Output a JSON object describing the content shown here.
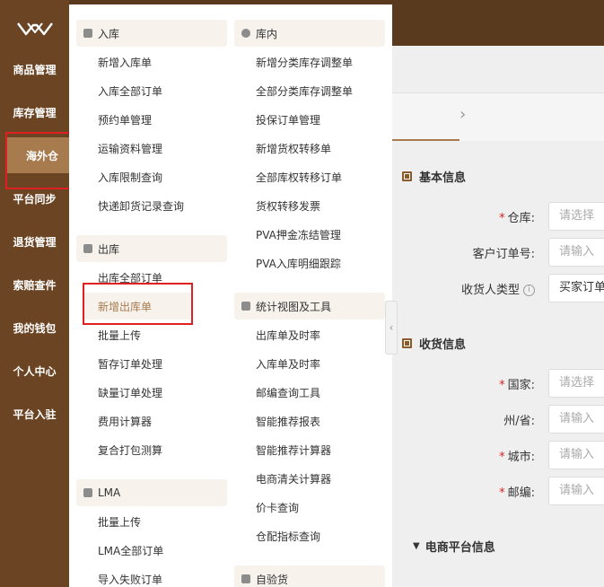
{
  "sidebar": {
    "items": [
      {
        "label": "商品管理"
      },
      {
        "label": "库存管理"
      },
      {
        "label": "海外仓"
      },
      {
        "label": "平台同步"
      },
      {
        "label": "退货管理"
      },
      {
        "label": "索赔查件"
      },
      {
        "label": "我的钱包"
      },
      {
        "label": "个人中心"
      },
      {
        "label": "平台入驻"
      }
    ]
  },
  "menu": {
    "inbound": {
      "title": "入库",
      "items": [
        "新增入库单",
        "入库全部订单",
        "预约单管理",
        "运输资料管理",
        "入库限制查询",
        "快递卸货记录查询"
      ]
    },
    "outbound": {
      "title": "出库",
      "items": [
        "出库全部订单",
        "新增出库单",
        "批量上传",
        "暂存订单处理",
        "缺量订单处理",
        "费用计算器",
        "复合打包测算"
      ]
    },
    "lma": {
      "title": "LMA",
      "items": [
        "批量上传",
        "LMA全部订单",
        "导入失败订单"
      ]
    },
    "inventory": {
      "title": "库内",
      "items": [
        "新增分类库存调整单",
        "全部分类库存调整单",
        "投保订单管理",
        "新增货权转移单",
        "全部库权转移订单",
        "货权转移发票",
        "PVA押金冻结管理",
        "PVA入库明细跟踪"
      ]
    },
    "stats": {
      "title": "统计视图及工具",
      "items": [
        "出库单及时率",
        "入库单及时率",
        "邮编查询工具",
        "智能推荐报表",
        "智能推荐计算器",
        "电商清关计算器",
        "价卡查询",
        "仓配指标查询"
      ]
    },
    "selfcheck": {
      "title": "自验货"
    }
  },
  "form": {
    "basic": {
      "title": "基本信息",
      "warehouse_label": "仓库:",
      "warehouse_placeholder": "请选择",
      "order_no_label": "客户订单号:",
      "order_no_placeholder": "请输入",
      "receiver_type_label": "收货人类型",
      "receiver_type_value": "买家订单"
    },
    "receiver": {
      "title": "收货信息",
      "country_label": "国家:",
      "country_placeholder": "请选择",
      "state_label": "州/省:",
      "state_placeholder": "请输入",
      "city_label": "城市:",
      "city_placeholder": "请输入",
      "zip_label": "邮编:",
      "zip_placeholder": "请输入"
    },
    "platform": {
      "title": "电商平台信息"
    }
  },
  "colors": {
    "sidebar": "#6b4423",
    "accent": "#a87b4f",
    "highlight_border": "#e02020"
  }
}
